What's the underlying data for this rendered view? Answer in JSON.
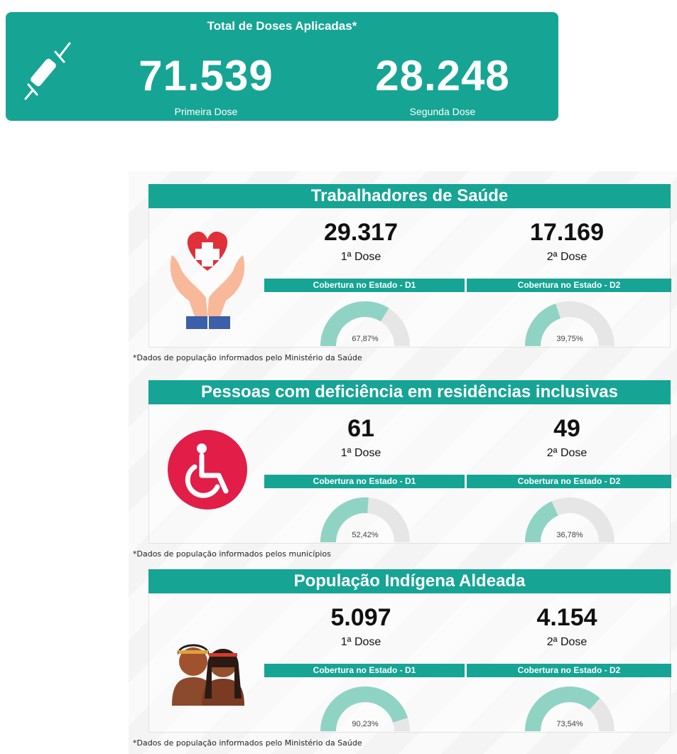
{
  "summary": {
    "title": "Total de Doses Aplicadas*",
    "icon": "syringe-icon",
    "first_dose_value": "71.539",
    "first_dose_label": "Primeira Dose",
    "second_dose_value": "28.248",
    "second_dose_label": "Segunda Dose"
  },
  "colors": {
    "accent": "#16a494",
    "gauge_fill": "#8fd3c5",
    "gauge_track": "#e6e6e6"
  },
  "sections": [
    {
      "title": "Trabalhadores de Saúde",
      "icon": "heart-hands-icon",
      "d1_value": "29.317",
      "d1_label": "1ª Dose",
      "d2_value": "17.169",
      "d2_label": "2ª Dose",
      "cov_d1_label": "Cobertura no Estado - D1",
      "cov_d2_label": "Cobertura no Estado - D2",
      "cov_d1_pct": "67,87%",
      "cov_d2_pct": "39,75%",
      "cov_d1_fraction": 0.6787,
      "cov_d2_fraction": 0.3975,
      "note": "*Dados de população informados pelo Ministério da Saúde"
    },
    {
      "title": "Pessoas com deficiência em residências inclusivas",
      "icon": "wheelchair-icon",
      "d1_value": "61",
      "d1_label": "1ª Dose",
      "d2_value": "49",
      "d2_label": "2ª Dose",
      "cov_d1_label": "Cobertura no Estado - D1",
      "cov_d2_label": "Cobertura no Estado - D2",
      "cov_d1_pct": "52,42%",
      "cov_d2_pct": "36,78%",
      "cov_d1_fraction": 0.5242,
      "cov_d2_fraction": 0.3678,
      "note": "*Dados de população informados pelos municípios"
    },
    {
      "title": "População Indígena Aldeada",
      "icon": "indigenous-people-icon",
      "d1_value": "5.097",
      "d1_label": "1ª Dose",
      "d2_value": "4.154",
      "d2_label": "2ª Dose",
      "cov_d1_label": "Cobertura no Estado - D1",
      "cov_d2_label": "Cobertura no Estado - D2",
      "cov_d1_pct": "90,23%",
      "cov_d2_pct": "73,54%",
      "cov_d1_fraction": 0.9023,
      "cov_d2_fraction": 0.7354,
      "note": "*Dados de população informados pelo Ministério da Saúde"
    }
  ]
}
